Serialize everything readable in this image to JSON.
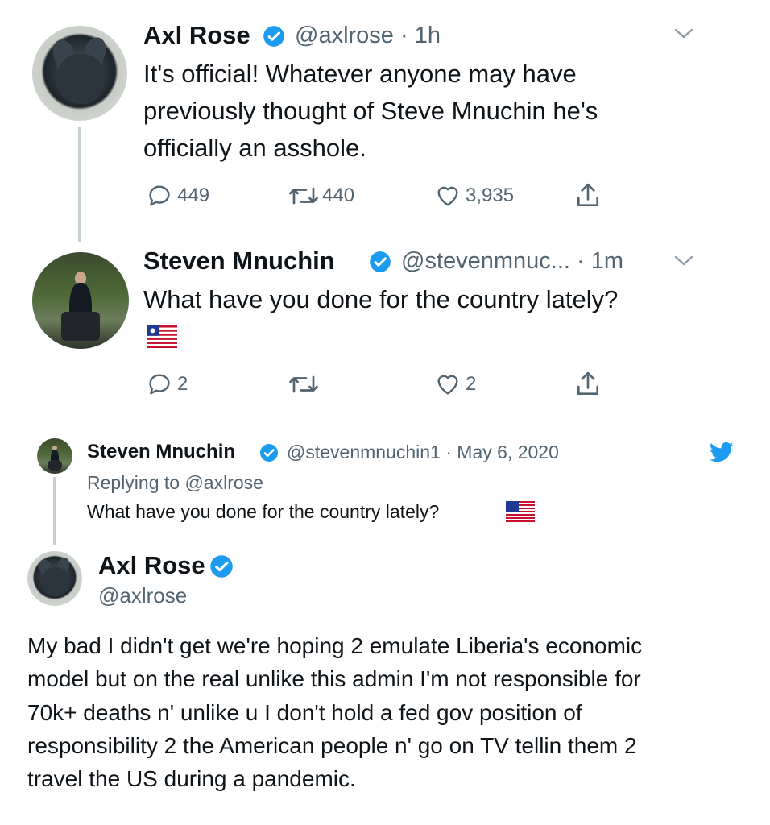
{
  "top_tweet": {
    "name": "Axl Rose",
    "handle_time": "@axlrose · 1h",
    "lines": [
      "It's official! Whatever anyone may have",
      "previously thought of Steve Mnuchin he's",
      "officially an asshole."
    ],
    "replies": "449",
    "retweets": "440",
    "likes": "3,935"
  },
  "reply_tweet": {
    "name": "Steven Mnuchin",
    "handle_time": "@stevenmnuc... · 1m",
    "text": "What have you done for the country lately?",
    "replies": "2",
    "retweets": "",
    "likes": "2"
  },
  "embedded_tweet": {
    "name": "Steven Mnuchin",
    "handle_date": "@stevenmnuchin1 · May 6, 2020",
    "replying_to": "Replying to @axlrose",
    "text": "What have you done for the country lately?"
  },
  "main_tweet": {
    "name": "Axl Rose",
    "handle": "@axlrose",
    "lines": [
      "My bad I didn't get we're hoping 2 emulate Liberia's economic",
      "model but on the real unlike this admin I'm not responsible for",
      "70k+ deaths n' unlike u I don't hold a fed gov position of",
      "responsibility 2 the American people n' go on TV tellin them 2",
      "travel the US during a pandemic."
    ]
  },
  "icons": {
    "verified": "verified-badge-icon",
    "reply": "reply-icon",
    "retweet": "retweet-icon",
    "like": "heart-icon",
    "share": "share-icon",
    "caret": "chevron-down-icon",
    "brand": "twitter-bird-icon"
  },
  "colors": {
    "verified_blue": "#1d9bf0",
    "muted_text": "#536471",
    "text": "#0f1419",
    "thread_line": "#c4cfd6"
  }
}
